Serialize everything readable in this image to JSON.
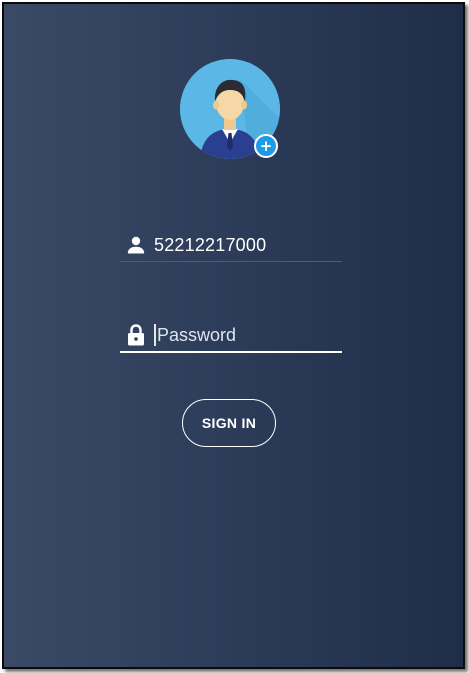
{
  "login": {
    "avatar_badge": "+",
    "username": {
      "icon": "person-icon",
      "value": "52212217000"
    },
    "password": {
      "icon": "lock-icon",
      "placeholder": "Password",
      "value": ""
    },
    "sign_in_label": "SIGN IN"
  },
  "colors": {
    "background_left": "#3a4a66",
    "background_right": "#1f2d48",
    "avatar_bg": "#5bb8e6",
    "badge": "#1e9be6",
    "text": "#ffffff"
  }
}
